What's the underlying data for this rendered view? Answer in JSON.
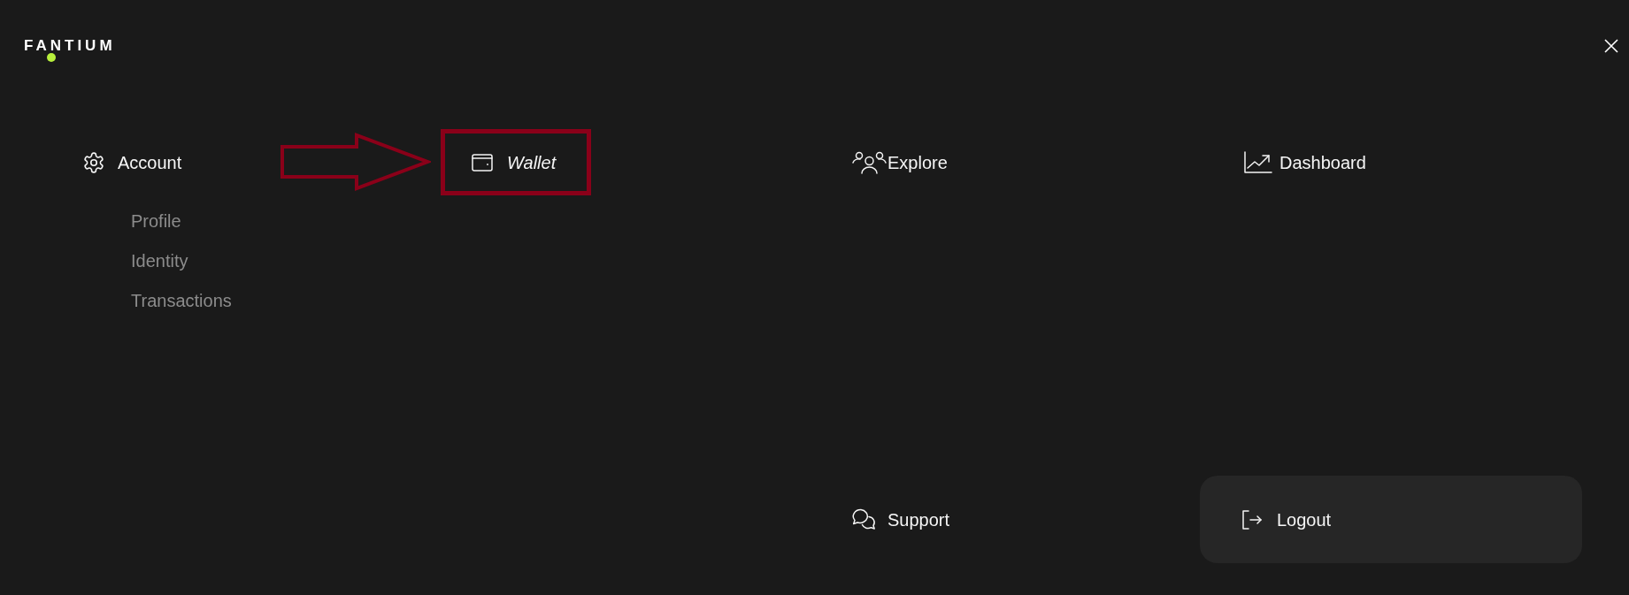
{
  "logo": {
    "text": "FANTIUM"
  },
  "menu": [
    {
      "label": "Account",
      "highlighted": false,
      "children": [
        {
          "label": "Profile"
        },
        {
          "label": "Identity"
        },
        {
          "label": "Transactions"
        }
      ]
    },
    {
      "label": "Wallet",
      "highlighted": true
    },
    {
      "label": "Explore",
      "highlighted": false
    },
    {
      "label": "Dashboard",
      "highlighted": false
    }
  ],
  "footer_menu": [
    {
      "label": "Support",
      "kind": "link"
    },
    {
      "label": "Logout",
      "kind": "card"
    }
  ]
}
